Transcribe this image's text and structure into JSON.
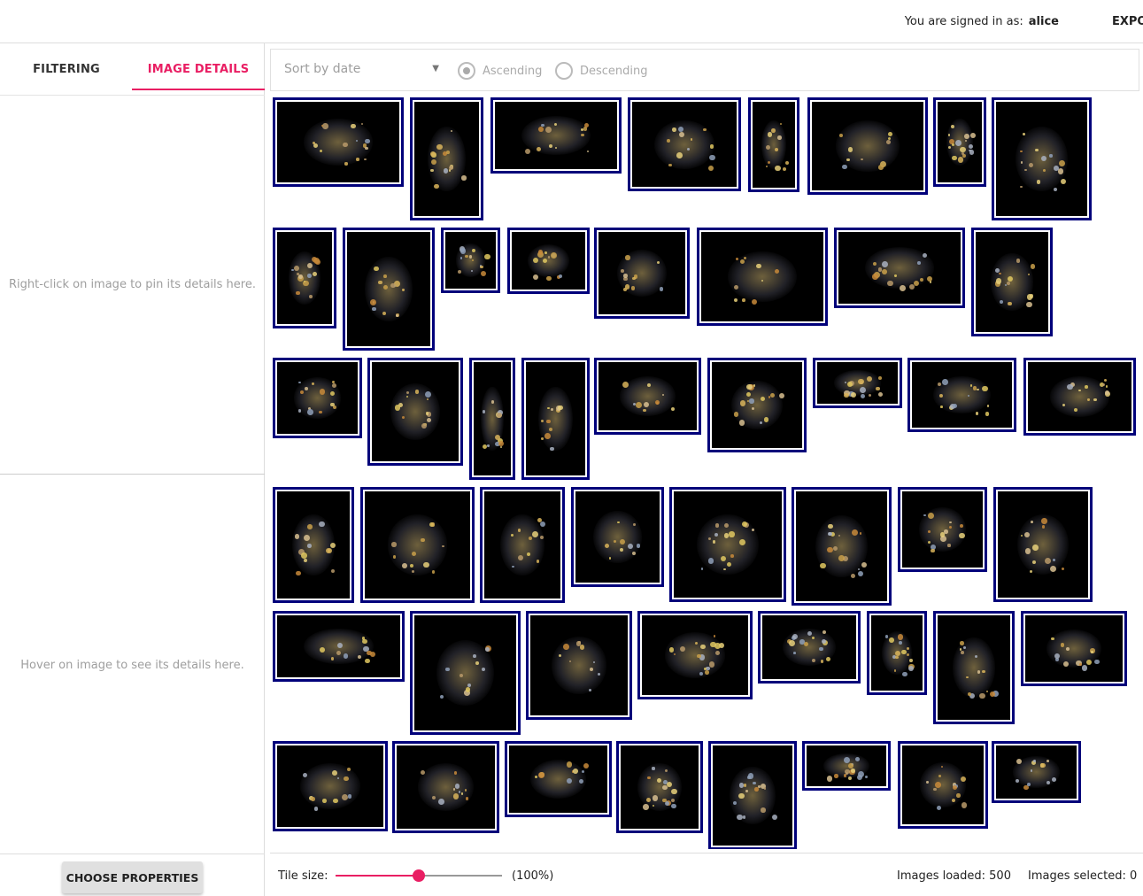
{
  "header": {
    "signed_in_label": "You are signed in as:",
    "user": "alice",
    "export_label": "EXPO"
  },
  "sidebar": {
    "tabs": [
      {
        "label": "FILTERING"
      },
      {
        "label": "IMAGE DETAILS"
      }
    ],
    "pin_hint": "Right-click on image to pin its details here.",
    "hover_hint": "Hover on image to see its details here.",
    "choose_button": "CHOOSE PROPERTIES"
  },
  "sort": {
    "placeholder": "Sort by date",
    "ascending": "Ascending",
    "descending": "Descending",
    "selected": "Ascending"
  },
  "footer": {
    "tile_size_label": "Tile size:",
    "tile_size_value": 50,
    "tile_size_percent": "(100%)",
    "images_loaded": "Images loaded: 500",
    "images_selected": "Images selected: 0"
  },
  "colors": {
    "accent": "#e91e63",
    "tile_border": "#00007a"
  },
  "gallery": {
    "tile_count": 51,
    "tile_content": "plankton microscopy images"
  }
}
